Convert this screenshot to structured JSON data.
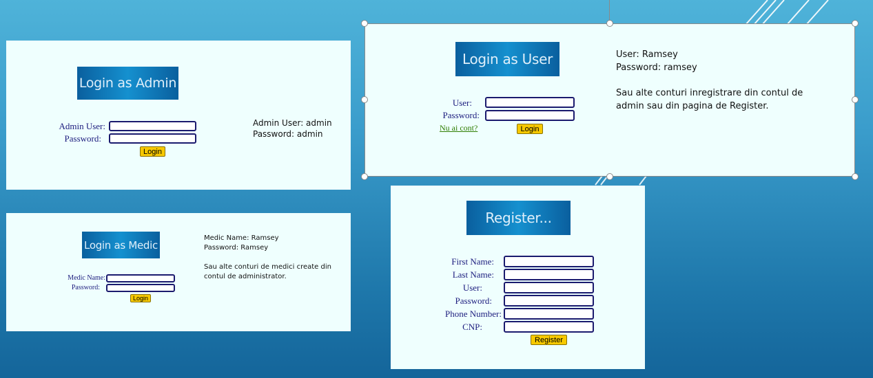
{
  "admin_panel": {
    "banner": "Login as Admin",
    "user_label": "Admin User:",
    "password_label": "Password:",
    "user_value": "",
    "password_value": "",
    "login_button": "Login",
    "credentials": [
      "Admin User: admin",
      "Password: admin"
    ]
  },
  "medic_panel": {
    "banner": "Login as Medic",
    "name_label": "Medic Name:",
    "password_label": "Password:",
    "name_value": "",
    "password_value": "",
    "login_button": "Login",
    "info": [
      "Medic Name: Ramsey",
      "Password: Ramsey",
      "Sau alte conturi de medici create din",
      "contul de administrator."
    ]
  },
  "user_panel": {
    "banner": "Login as User",
    "user_label": "User:",
    "password_label": "Password:",
    "user_value": "",
    "password_value": "",
    "register_link": "Nu ai cont?",
    "login_button": "Login",
    "info": [
      "User: Ramsey",
      "Password: ramsey",
      "Sau alte conturi inregistrare din contul de",
      "admin sau din pagina de Register."
    ]
  },
  "register_panel": {
    "banner": "Register...",
    "fields": [
      {
        "label": "First Name:",
        "value": ""
      },
      {
        "label": "Last Name:",
        "value": ""
      },
      {
        "label": "User:",
        "value": ""
      },
      {
        "label": "Password:",
        "value": ""
      },
      {
        "label": "Phone Number:",
        "value": ""
      },
      {
        "label": "CNP:",
        "value": ""
      }
    ],
    "register_button": "Register"
  },
  "colors": {
    "panel_bg": "#effffe",
    "banner_blue": "#1590cf",
    "button_yellow": "#f7c900",
    "label_navy": "#1c1c7e",
    "link_green": "#2e7d00"
  }
}
